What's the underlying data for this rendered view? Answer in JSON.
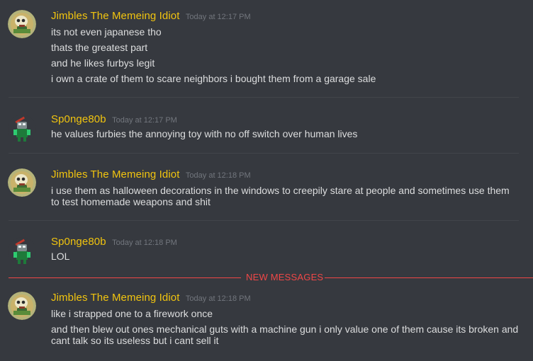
{
  "colors": {
    "background": "#36393f",
    "username_yellow": "#f1c40f",
    "timestamp": "#72767d",
    "new_messages": "#f04747",
    "text": "#dcddde"
  },
  "new_messages_label": "NEW MESSAGES",
  "groups": [
    {
      "username": "Jimbles The Memeing Idiot",
      "timestamp": "Today at 12:17 PM",
      "avatar_icon": "skeleton-avatar-icon",
      "messages": [
        "its not even japanese tho",
        "thats the greatest part",
        "and he likes furbys legit",
        "i own a crate of them to scare neighbors i bought them from a garage sale"
      ]
    },
    {
      "username": "Sp0nge80b",
      "timestamp": "Today at 12:17 PM",
      "avatar_icon": "robot-avatar-icon",
      "messages": [
        "he values furbies the annoying toy with no off switch over human lives"
      ]
    },
    {
      "username": "Jimbles The Memeing Idiot",
      "timestamp": "Today at 12:18 PM",
      "avatar_icon": "skeleton-avatar-icon",
      "messages": [
        "i use them as halloween decorations in the windows to creepily stare at people and sometimes use them",
        "to test homemade weapons and shit"
      ]
    },
    {
      "username": "Sp0nge80b",
      "timestamp": "Today at 12:18 PM",
      "avatar_icon": "robot-avatar-icon",
      "messages": [
        "LOL"
      ]
    },
    {
      "username": "Jimbles The Memeing Idiot",
      "timestamp": "Today at 12:18 PM",
      "avatar_icon": "skeleton-avatar-icon",
      "messages": [
        "like i strapped one to a firework once",
        "and then blew out ones mechanical guts with a machine gun i only value one of them cause its broken and",
        "cant talk so its useless but i cant sell it"
      ]
    }
  ]
}
